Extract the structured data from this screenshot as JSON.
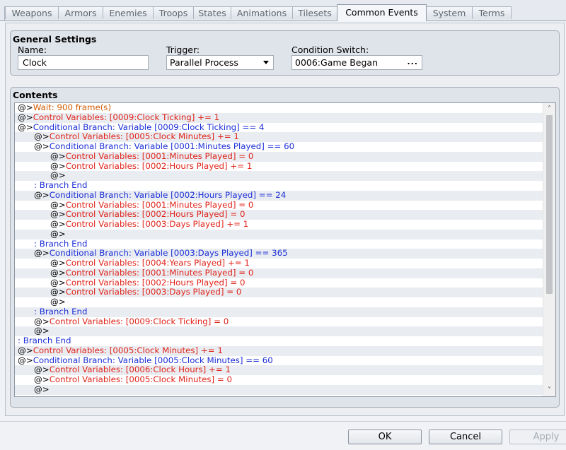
{
  "tabs": [
    "Weapons",
    "Armors",
    "Enemies",
    "Troops",
    "States",
    "Animations",
    "Tilesets",
    "Common Events",
    "System",
    "Terms"
  ],
  "active_tab": "Common Events",
  "general": {
    "title": "General Settings",
    "name_label": "Name:",
    "name_value": "Clock",
    "trigger_label": "Trigger:",
    "trigger_value": "Parallel Process",
    "switch_label": "Condition Switch:",
    "switch_value": "0006:Game Began",
    "switch_button": "..."
  },
  "contents": {
    "title": "Contents",
    "rows": [
      {
        "indent": 0,
        "prefix": "@>",
        "text": "Wait: 900 frame(s)",
        "color": "orange"
      },
      {
        "indent": 0,
        "prefix": "@>",
        "text": "Control Variables: [0009:Clock Ticking] += 1",
        "color": "red"
      },
      {
        "indent": 0,
        "prefix": "@>",
        "text": "Conditional Branch: Variable [0009:Clock Ticking] == 4",
        "color": "blue"
      },
      {
        "indent": 1,
        "prefix": "@>",
        "text": "Control Variables: [0005:Clock Minutes] += 1",
        "color": "red"
      },
      {
        "indent": 1,
        "prefix": "@>",
        "text": "Conditional Branch: Variable [0001:Minutes Played] == 60",
        "color": "blue"
      },
      {
        "indent": 2,
        "prefix": "@>",
        "text": "Control Variables: [0001:Minutes Played] = 0",
        "color": "red"
      },
      {
        "indent": 2,
        "prefix": "@>",
        "text": "Control Variables: [0002:Hours Played] += 1",
        "color": "red"
      },
      {
        "indent": 2,
        "prefix": "@>",
        "text": "",
        "color": "red"
      },
      {
        "indent": 1,
        "prefix": " : ",
        "text": "Branch End",
        "color": "blue"
      },
      {
        "indent": 1,
        "prefix": "@>",
        "text": "Conditional Branch: Variable [0002:Hours Played] == 24",
        "color": "blue"
      },
      {
        "indent": 2,
        "prefix": "@>",
        "text": "Control Variables: [0001:Minutes Played] = 0",
        "color": "red"
      },
      {
        "indent": 2,
        "prefix": "@>",
        "text": "Control Variables: [0002:Hours Played] = 0",
        "color": "red"
      },
      {
        "indent": 2,
        "prefix": "@>",
        "text": "Control Variables: [0003:Days Played] += 1",
        "color": "red"
      },
      {
        "indent": 2,
        "prefix": "@>",
        "text": "",
        "color": "red"
      },
      {
        "indent": 1,
        "prefix": " : ",
        "text": "Branch End",
        "color": "blue"
      },
      {
        "indent": 1,
        "prefix": "@>",
        "text": "Conditional Branch: Variable [0003:Days Played] == 365",
        "color": "blue"
      },
      {
        "indent": 2,
        "prefix": "@>",
        "text": "Control Variables: [0004:Years Played] += 1",
        "color": "red"
      },
      {
        "indent": 2,
        "prefix": "@>",
        "text": "Control Variables: [0001:Minutes Played] = 0",
        "color": "red"
      },
      {
        "indent": 2,
        "prefix": "@>",
        "text": "Control Variables: [0002:Hours Played] = 0",
        "color": "red"
      },
      {
        "indent": 2,
        "prefix": "@>",
        "text": "Control Variables: [0003:Days Played] = 0",
        "color": "red"
      },
      {
        "indent": 2,
        "prefix": "@>",
        "text": "",
        "color": "red"
      },
      {
        "indent": 1,
        "prefix": " : ",
        "text": "Branch End",
        "color": "blue"
      },
      {
        "indent": 1,
        "prefix": "@>",
        "text": "Control Variables: [0009:Clock Ticking] = 0",
        "color": "red"
      },
      {
        "indent": 1,
        "prefix": "@>",
        "text": "",
        "color": "red"
      },
      {
        "indent": 0,
        "prefix": " : ",
        "text": "Branch End",
        "color": "blue"
      },
      {
        "indent": 0,
        "prefix": "@>",
        "text": "Control Variables: [0005:Clock Minutes] += 1",
        "color": "red"
      },
      {
        "indent": 0,
        "prefix": "@>",
        "text": "Conditional Branch: Variable [0005:Clock Minutes] == 60",
        "color": "blue"
      },
      {
        "indent": 1,
        "prefix": "@>",
        "text": "Control Variables: [0006:Clock Hours] += 1",
        "color": "red"
      },
      {
        "indent": 1,
        "prefix": "@>",
        "text": "Control Variables: [0005:Clock Minutes] = 0",
        "color": "red"
      },
      {
        "indent": 1,
        "prefix": "@>",
        "text": "",
        "color": "red"
      }
    ]
  },
  "buttons": {
    "ok": "OK",
    "cancel": "Cancel",
    "apply": "Apply"
  },
  "scroll_icons": {
    "up": "chevron-up-icon",
    "down": "chevron-down-icon"
  }
}
